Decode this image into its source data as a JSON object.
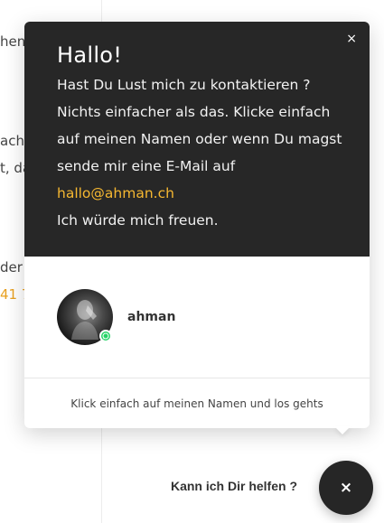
{
  "background_fragments": [
    {
      "text": "hen"
    },
    {
      "text": "ach"
    },
    {
      "text": "t, da"
    },
    {
      "text": "der"
    },
    {
      "text": "41 7"
    }
  ],
  "popup": {
    "close_icon": "×",
    "title": "Hallo!",
    "lines": [
      "Hast Du Lust mich zu kontaktieren ?",
      "Nichts einfacher als das. Klicke einfach",
      "auf meinen Namen oder wenn Du magst",
      "sende mir eine E-Mail auf"
    ],
    "email": "hallo@ahman.ch",
    "closing": "Ich würde mich freuen.",
    "agent": {
      "name": "ahman",
      "status_icon": "whatsapp-icon"
    },
    "footer": "Klick einfach auf meinen Namen und los gehts"
  },
  "launcher": {
    "label": "Kann ich Dir helfen ?",
    "icon": "×"
  },
  "colors": {
    "header_bg": "#272727",
    "email_link": "#f5b731",
    "whatsapp_green": "#25d366",
    "launcher_bg": "#262626"
  }
}
